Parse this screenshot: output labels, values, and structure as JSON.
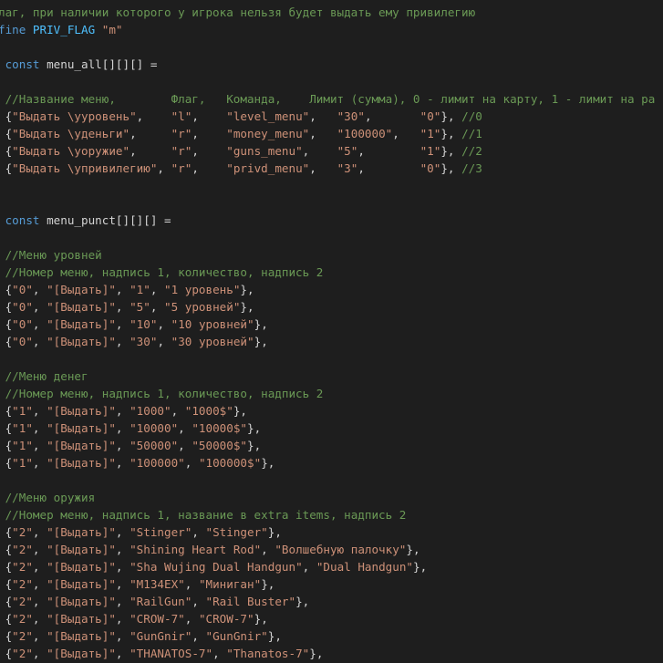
{
  "theme": {
    "background": "#1e1e1e",
    "comment": "#6a9955",
    "keyword": "#569cd6",
    "macro": "#4fc1ff",
    "string": "#ce9178",
    "text": "#d4d4d4"
  },
  "lines": [
    [
      {
        "t": "comment",
        "v": "лаг, при наличии которого у игрока нельзя будет выдать ему привилегию"
      }
    ],
    [
      {
        "t": "keyword",
        "v": "fine "
      },
      {
        "t": "macro",
        "v": "PRIV_FLAG"
      },
      {
        "t": "plain",
        "v": " "
      },
      {
        "t": "string",
        "v": "\"m\""
      }
    ],
    [],
    [
      {
        "t": "plain",
        "v": " "
      },
      {
        "t": "keyword",
        "v": "const"
      },
      {
        "t": "plain",
        "v": " menu_all[][][] ="
      }
    ],
    [],
    [
      {
        "t": "plain",
        "v": " "
      },
      {
        "t": "comment",
        "v": "//Название меню,        Флаг,   Команда,    Лимит (сумма), 0 - лимит на карту, 1 - лимит на ра"
      }
    ],
    [
      {
        "t": "plain",
        "v": " {"
      },
      {
        "t": "string",
        "v": "\"Выдать \\yуровень\""
      },
      {
        "t": "plain",
        "v": ",    "
      },
      {
        "t": "string",
        "v": "\"l\""
      },
      {
        "t": "plain",
        "v": ",    "
      },
      {
        "t": "string",
        "v": "\"level_menu\""
      },
      {
        "t": "plain",
        "v": ",   "
      },
      {
        "t": "string",
        "v": "\"30\""
      },
      {
        "t": "plain",
        "v": ",       "
      },
      {
        "t": "string",
        "v": "\"0\""
      },
      {
        "t": "plain",
        "v": "}, "
      },
      {
        "t": "comment",
        "v": "//0"
      }
    ],
    [
      {
        "t": "plain",
        "v": " {"
      },
      {
        "t": "string",
        "v": "\"Выдать \\yденьги\""
      },
      {
        "t": "plain",
        "v": ",     "
      },
      {
        "t": "string",
        "v": "\"r\""
      },
      {
        "t": "plain",
        "v": ",    "
      },
      {
        "t": "string",
        "v": "\"money_menu\""
      },
      {
        "t": "plain",
        "v": ",   "
      },
      {
        "t": "string",
        "v": "\"100000\""
      },
      {
        "t": "plain",
        "v": ",   "
      },
      {
        "t": "string",
        "v": "\"1\""
      },
      {
        "t": "plain",
        "v": "}, "
      },
      {
        "t": "comment",
        "v": "//1"
      }
    ],
    [
      {
        "t": "plain",
        "v": " {"
      },
      {
        "t": "string",
        "v": "\"Выдать \\yоружие\""
      },
      {
        "t": "plain",
        "v": ",     "
      },
      {
        "t": "string",
        "v": "\"r\""
      },
      {
        "t": "plain",
        "v": ",    "
      },
      {
        "t": "string",
        "v": "\"guns_menu\""
      },
      {
        "t": "plain",
        "v": ",    "
      },
      {
        "t": "string",
        "v": "\"5\""
      },
      {
        "t": "plain",
        "v": ",        "
      },
      {
        "t": "string",
        "v": "\"1\""
      },
      {
        "t": "plain",
        "v": "}, "
      },
      {
        "t": "comment",
        "v": "//2"
      }
    ],
    [
      {
        "t": "plain",
        "v": " {"
      },
      {
        "t": "string",
        "v": "\"Выдать \\yпривилегию\""
      },
      {
        "t": "plain",
        "v": ", "
      },
      {
        "t": "string",
        "v": "\"r\""
      },
      {
        "t": "plain",
        "v": ",    "
      },
      {
        "t": "string",
        "v": "\"privd_menu\""
      },
      {
        "t": "plain",
        "v": ",   "
      },
      {
        "t": "string",
        "v": "\"3\""
      },
      {
        "t": "plain",
        "v": ",        "
      },
      {
        "t": "string",
        "v": "\"0\""
      },
      {
        "t": "plain",
        "v": "}, "
      },
      {
        "t": "comment",
        "v": "//3"
      }
    ],
    [],
    [],
    [
      {
        "t": "plain",
        "v": " "
      },
      {
        "t": "keyword",
        "v": "const"
      },
      {
        "t": "plain",
        "v": " menu_punct[][][] ="
      }
    ],
    [],
    [
      {
        "t": "plain",
        "v": " "
      },
      {
        "t": "comment",
        "v": "//Меню уровней"
      }
    ],
    [
      {
        "t": "plain",
        "v": " "
      },
      {
        "t": "comment",
        "v": "//Номер меню, надпись 1, количество, надпись 2"
      }
    ],
    [
      {
        "t": "plain",
        "v": " {"
      },
      {
        "t": "string",
        "v": "\"0\""
      },
      {
        "t": "plain",
        "v": ", "
      },
      {
        "t": "string",
        "v": "\"[Выдать]\""
      },
      {
        "t": "plain",
        "v": ", "
      },
      {
        "t": "string",
        "v": "\"1\""
      },
      {
        "t": "plain",
        "v": ", "
      },
      {
        "t": "string",
        "v": "\"1 уровень\""
      },
      {
        "t": "plain",
        "v": "},"
      }
    ],
    [
      {
        "t": "plain",
        "v": " {"
      },
      {
        "t": "string",
        "v": "\"0\""
      },
      {
        "t": "plain",
        "v": ", "
      },
      {
        "t": "string",
        "v": "\"[Выдать]\""
      },
      {
        "t": "plain",
        "v": ", "
      },
      {
        "t": "string",
        "v": "\"5\""
      },
      {
        "t": "plain",
        "v": ", "
      },
      {
        "t": "string",
        "v": "\"5 уровней\""
      },
      {
        "t": "plain",
        "v": "},"
      }
    ],
    [
      {
        "t": "plain",
        "v": " {"
      },
      {
        "t": "string",
        "v": "\"0\""
      },
      {
        "t": "plain",
        "v": ", "
      },
      {
        "t": "string",
        "v": "\"[Выдать]\""
      },
      {
        "t": "plain",
        "v": ", "
      },
      {
        "t": "string",
        "v": "\"10\""
      },
      {
        "t": "plain",
        "v": ", "
      },
      {
        "t": "string",
        "v": "\"10 уровней\""
      },
      {
        "t": "plain",
        "v": "},"
      }
    ],
    [
      {
        "t": "plain",
        "v": " {"
      },
      {
        "t": "string",
        "v": "\"0\""
      },
      {
        "t": "plain",
        "v": ", "
      },
      {
        "t": "string",
        "v": "\"[Выдать]\""
      },
      {
        "t": "plain",
        "v": ", "
      },
      {
        "t": "string",
        "v": "\"30\""
      },
      {
        "t": "plain",
        "v": ", "
      },
      {
        "t": "string",
        "v": "\"30 уровней\""
      },
      {
        "t": "plain",
        "v": "},"
      }
    ],
    [],
    [
      {
        "t": "plain",
        "v": " "
      },
      {
        "t": "comment",
        "v": "//Меню денег"
      }
    ],
    [
      {
        "t": "plain",
        "v": " "
      },
      {
        "t": "comment",
        "v": "//Номер меню, надпись 1, количество, надпись 2"
      }
    ],
    [
      {
        "t": "plain",
        "v": " {"
      },
      {
        "t": "string",
        "v": "\"1\""
      },
      {
        "t": "plain",
        "v": ", "
      },
      {
        "t": "string",
        "v": "\"[Выдать]\""
      },
      {
        "t": "plain",
        "v": ", "
      },
      {
        "t": "string",
        "v": "\"1000\""
      },
      {
        "t": "plain",
        "v": ", "
      },
      {
        "t": "string",
        "v": "\"1000$\""
      },
      {
        "t": "plain",
        "v": "},"
      }
    ],
    [
      {
        "t": "plain",
        "v": " {"
      },
      {
        "t": "string",
        "v": "\"1\""
      },
      {
        "t": "plain",
        "v": ", "
      },
      {
        "t": "string",
        "v": "\"[Выдать]\""
      },
      {
        "t": "plain",
        "v": ", "
      },
      {
        "t": "string",
        "v": "\"10000\""
      },
      {
        "t": "plain",
        "v": ", "
      },
      {
        "t": "string",
        "v": "\"10000$\""
      },
      {
        "t": "plain",
        "v": "},"
      }
    ],
    [
      {
        "t": "plain",
        "v": " {"
      },
      {
        "t": "string",
        "v": "\"1\""
      },
      {
        "t": "plain",
        "v": ", "
      },
      {
        "t": "string",
        "v": "\"[Выдать]\""
      },
      {
        "t": "plain",
        "v": ", "
      },
      {
        "t": "string",
        "v": "\"50000\""
      },
      {
        "t": "plain",
        "v": ", "
      },
      {
        "t": "string",
        "v": "\"50000$\""
      },
      {
        "t": "plain",
        "v": "},"
      }
    ],
    [
      {
        "t": "plain",
        "v": " {"
      },
      {
        "t": "string",
        "v": "\"1\""
      },
      {
        "t": "plain",
        "v": ", "
      },
      {
        "t": "string",
        "v": "\"[Выдать]\""
      },
      {
        "t": "plain",
        "v": ", "
      },
      {
        "t": "string",
        "v": "\"100000\""
      },
      {
        "t": "plain",
        "v": ", "
      },
      {
        "t": "string",
        "v": "\"100000$\""
      },
      {
        "t": "plain",
        "v": "},"
      }
    ],
    [],
    [
      {
        "t": "plain",
        "v": " "
      },
      {
        "t": "comment",
        "v": "//Меню оружия"
      }
    ],
    [
      {
        "t": "plain",
        "v": " "
      },
      {
        "t": "comment",
        "v": "//Номер меню, надпись 1, название в extra items, надпись 2"
      }
    ],
    [
      {
        "t": "plain",
        "v": " {"
      },
      {
        "t": "string",
        "v": "\"2\""
      },
      {
        "t": "plain",
        "v": ", "
      },
      {
        "t": "string",
        "v": "\"[Выдать]\""
      },
      {
        "t": "plain",
        "v": ", "
      },
      {
        "t": "string",
        "v": "\"Stinger\""
      },
      {
        "t": "plain",
        "v": ", "
      },
      {
        "t": "string",
        "v": "\"Stinger\""
      },
      {
        "t": "plain",
        "v": "},"
      }
    ],
    [
      {
        "t": "plain",
        "v": " {"
      },
      {
        "t": "string",
        "v": "\"2\""
      },
      {
        "t": "plain",
        "v": ", "
      },
      {
        "t": "string",
        "v": "\"[Выдать]\""
      },
      {
        "t": "plain",
        "v": ", "
      },
      {
        "t": "string",
        "v": "\"Shining Heart Rod\""
      },
      {
        "t": "plain",
        "v": ", "
      },
      {
        "t": "string",
        "v": "\"Волшебную палочку\""
      },
      {
        "t": "plain",
        "v": "},"
      }
    ],
    [
      {
        "t": "plain",
        "v": " {"
      },
      {
        "t": "string",
        "v": "\"2\""
      },
      {
        "t": "plain",
        "v": ", "
      },
      {
        "t": "string",
        "v": "\"[Выдать]\""
      },
      {
        "t": "plain",
        "v": ", "
      },
      {
        "t": "string",
        "v": "\"Sha Wujing Dual Handgun\""
      },
      {
        "t": "plain",
        "v": ", "
      },
      {
        "t": "string",
        "v": "\"Dual Handgun\""
      },
      {
        "t": "plain",
        "v": "},"
      }
    ],
    [
      {
        "t": "plain",
        "v": " {"
      },
      {
        "t": "string",
        "v": "\"2\""
      },
      {
        "t": "plain",
        "v": ", "
      },
      {
        "t": "string",
        "v": "\"[Выдать]\""
      },
      {
        "t": "plain",
        "v": ", "
      },
      {
        "t": "string",
        "v": "\"M134EX\""
      },
      {
        "t": "plain",
        "v": ", "
      },
      {
        "t": "string",
        "v": "\"Миниган\""
      },
      {
        "t": "plain",
        "v": "},"
      }
    ],
    [
      {
        "t": "plain",
        "v": " {"
      },
      {
        "t": "string",
        "v": "\"2\""
      },
      {
        "t": "plain",
        "v": ", "
      },
      {
        "t": "string",
        "v": "\"[Выдать]\""
      },
      {
        "t": "plain",
        "v": ", "
      },
      {
        "t": "string",
        "v": "\"RailGun\""
      },
      {
        "t": "plain",
        "v": ", "
      },
      {
        "t": "string",
        "v": "\"Rail Buster\""
      },
      {
        "t": "plain",
        "v": "},"
      }
    ],
    [
      {
        "t": "plain",
        "v": " {"
      },
      {
        "t": "string",
        "v": "\"2\""
      },
      {
        "t": "plain",
        "v": ", "
      },
      {
        "t": "string",
        "v": "\"[Выдать]\""
      },
      {
        "t": "plain",
        "v": ", "
      },
      {
        "t": "string",
        "v": "\"CROW-7\""
      },
      {
        "t": "plain",
        "v": ", "
      },
      {
        "t": "string",
        "v": "\"CROW-7\""
      },
      {
        "t": "plain",
        "v": "},"
      }
    ],
    [
      {
        "t": "plain",
        "v": " {"
      },
      {
        "t": "string",
        "v": "\"2\""
      },
      {
        "t": "plain",
        "v": ", "
      },
      {
        "t": "string",
        "v": "\"[Выдать]\""
      },
      {
        "t": "plain",
        "v": ", "
      },
      {
        "t": "string",
        "v": "\"GunGnir\""
      },
      {
        "t": "plain",
        "v": ", "
      },
      {
        "t": "string",
        "v": "\"GunGnir\""
      },
      {
        "t": "plain",
        "v": "},"
      }
    ],
    [
      {
        "t": "plain",
        "v": " {"
      },
      {
        "t": "string",
        "v": "\"2\""
      },
      {
        "t": "plain",
        "v": ", "
      },
      {
        "t": "string",
        "v": "\"[Выдать]\""
      },
      {
        "t": "plain",
        "v": ", "
      },
      {
        "t": "string",
        "v": "\"THANATOS-7\""
      },
      {
        "t": "plain",
        "v": ", "
      },
      {
        "t": "string",
        "v": "\"Thanatos-7\""
      },
      {
        "t": "plain",
        "v": "},"
      }
    ]
  ]
}
